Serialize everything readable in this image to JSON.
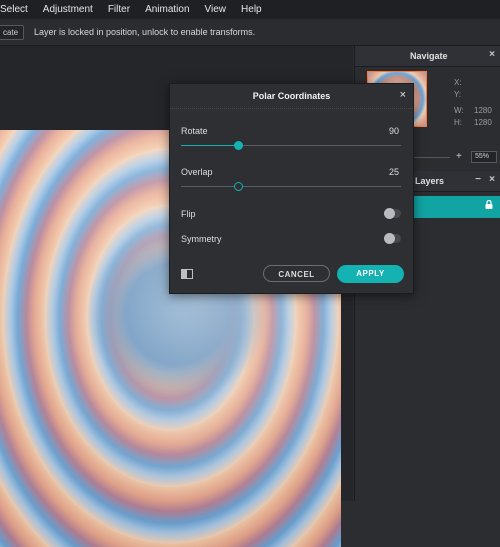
{
  "menu": [
    "Select",
    "Adjustment",
    "Filter",
    "Animation",
    "View",
    "Help"
  ],
  "options_bar": {
    "button_text": "cate",
    "message": "Layer is locked in position, unlock to enable transforms."
  },
  "navigate": {
    "title": "Navigate",
    "x_label": "X:",
    "y_label": "Y:",
    "w_label": "W:",
    "w_value": "1280",
    "h_label": "H:",
    "h_value": "1280",
    "zoom_plus": "+",
    "zoom_value": "55%"
  },
  "layers": {
    "title": "Layers",
    "items": [
      {
        "name": "ound",
        "locked": true
      }
    ]
  },
  "dialog": {
    "title": "Polar Coordinates",
    "rotate": {
      "label": "Rotate",
      "value": "90",
      "fraction": 0.26
    },
    "overlap": {
      "label": "Overlap",
      "value": "25",
      "fraction": 0.26
    },
    "flip": {
      "label": "Flip",
      "on": false
    },
    "symmetry": {
      "label": "Symmetry",
      "on": false
    },
    "cancel_label": "CANCEL",
    "apply_label": "APPLY"
  },
  "panel_controls": {
    "close": "×",
    "minimize": "−"
  },
  "colors": {
    "accent": "#14b2b2",
    "background": "#2b2d31",
    "menubar": "#1f2023"
  }
}
